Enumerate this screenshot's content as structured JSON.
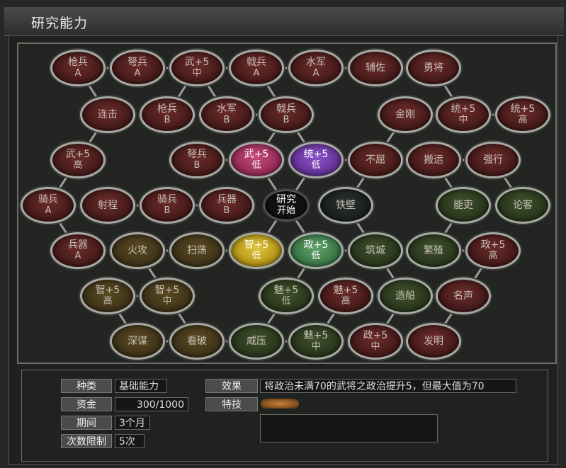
{
  "window": {
    "title": "研究能力"
  },
  "nodes": [
    {
      "id": "qiangbing_a",
      "l1": "枪兵",
      "l2": "A"
    },
    {
      "id": "nubing_a",
      "l1": "弩兵",
      "l2": "A"
    },
    {
      "id": "wu5_zhong",
      "l1": "武+5",
      "l2": "中"
    },
    {
      "id": "jibing_a",
      "l1": "戟兵",
      "l2": "A"
    },
    {
      "id": "shuijun_a",
      "l1": "水军",
      "l2": "A"
    },
    {
      "id": "fuzuo",
      "l1": "辅佐",
      "l2": ""
    },
    {
      "id": "yongjiang",
      "l1": "勇将",
      "l2": ""
    },
    {
      "id": "lianji",
      "l1": "连击",
      "l2": ""
    },
    {
      "id": "qiangbing_b",
      "l1": "枪兵",
      "l2": "B"
    },
    {
      "id": "shuijun_b",
      "l1": "水军",
      "l2": "B"
    },
    {
      "id": "jibing_b",
      "l1": "戟兵",
      "l2": "B"
    },
    {
      "id": "jingang",
      "l1": "金刚",
      "l2": ""
    },
    {
      "id": "tong5_zhong",
      "l1": "统+5",
      "l2": "中"
    },
    {
      "id": "tong5_gao",
      "l1": "统+5",
      "l2": "高"
    },
    {
      "id": "wu5_gao",
      "l1": "武+5",
      "l2": "高"
    },
    {
      "id": "nubing_b",
      "l1": "弩兵",
      "l2": "B"
    },
    {
      "id": "wu5_di",
      "l1": "武+5",
      "l2": "低"
    },
    {
      "id": "tong5_di",
      "l1": "统+5",
      "l2": "低"
    },
    {
      "id": "buqu",
      "l1": "不屈",
      "l2": ""
    },
    {
      "id": "banyun",
      "l1": "搬运",
      "l2": ""
    },
    {
      "id": "qiangxing",
      "l1": "强行",
      "l2": ""
    },
    {
      "id": "qibing_a",
      "l1": "骑兵",
      "l2": "A"
    },
    {
      "id": "shecheng",
      "l1": "射程",
      "l2": ""
    },
    {
      "id": "qibing_b",
      "l1": "骑兵",
      "l2": "B"
    },
    {
      "id": "bingqi_b",
      "l1": "兵器",
      "l2": "B"
    },
    {
      "id": "center",
      "l1": "研究",
      "l2": "开始"
    },
    {
      "id": "tiebi",
      "l1": "铁壁",
      "l2": ""
    },
    {
      "id": "nengli",
      "l1": "能吏",
      "l2": ""
    },
    {
      "id": "lunke",
      "l1": "论客",
      "l2": ""
    },
    {
      "id": "bingqi_a",
      "l1": "兵器",
      "l2": "A"
    },
    {
      "id": "huogong",
      "l1": "火攻",
      "l2": ""
    },
    {
      "id": "saodang",
      "l1": "扫荡",
      "l2": ""
    },
    {
      "id": "zhi5_di",
      "l1": "智+5",
      "l2": "低"
    },
    {
      "id": "zheng5_di",
      "l1": "政+5",
      "l2": "低"
    },
    {
      "id": "zhucheng",
      "l1": "筑城",
      "l2": ""
    },
    {
      "id": "fanzhi",
      "l1": "繁殖",
      "l2": ""
    },
    {
      "id": "zheng5_gao",
      "l1": "政+5",
      "l2": "高"
    },
    {
      "id": "zhi5_gao",
      "l1": "智+5",
      "l2": "高"
    },
    {
      "id": "zhi5_zhong",
      "l1": "智+5",
      "l2": "中"
    },
    {
      "id": "mei5_di",
      "l1": "魅+5",
      "l2": "低"
    },
    {
      "id": "mei5_gao",
      "l1": "魅+5",
      "l2": "高"
    },
    {
      "id": "zaochuan",
      "l1": "造船",
      "l2": ""
    },
    {
      "id": "mingsheng",
      "l1": "名声",
      "l2": ""
    },
    {
      "id": "shenmou",
      "l1": "深谋",
      "l2": ""
    },
    {
      "id": "kanpo",
      "l1": "看破",
      "l2": ""
    },
    {
      "id": "weiya",
      "l1": "威压",
      "l2": ""
    },
    {
      "id": "mei5_zhong",
      "l1": "魅+5",
      "l2": "中"
    },
    {
      "id": "zheng5_zhong",
      "l1": "政+5",
      "l2": "中"
    },
    {
      "id": "faming",
      "l1": "发明",
      "l2": ""
    }
  ],
  "info": {
    "type_label": "种类",
    "type_value": "基础能力",
    "funds_label": "资金",
    "funds_value": "300/1000",
    "period_label": "期间",
    "period_value": "3个月",
    "limit_label": "次数限制",
    "limit_value": "5次",
    "effect_label": "效果",
    "effect_value": "将政治未满70的武将之政治提升5，但最大值为70",
    "skill_label": "特技"
  }
}
